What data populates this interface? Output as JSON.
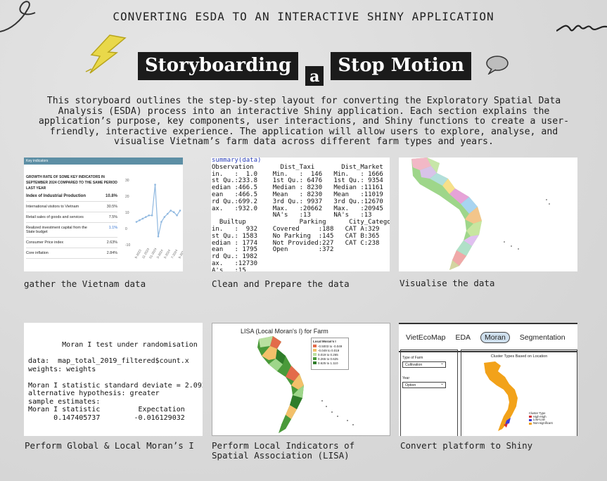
{
  "header": {
    "title": "CONVERTING ESDA TO AN INTERACTIVE SHINY APPLICATION",
    "banner_word1": "Storyboarding",
    "banner_word2": "a",
    "banner_word3": "Stop Motion"
  },
  "intro": "This storyboard outlines the step-by-step layout for converting the Exploratory Spatial Data Analysis (ESDA) process into an interactive Shiny application. Each section explains the application’s purpose, key components, user interactions, and Shiny functions to create a user-friendly, interactive experience. The application will allow users to explore, analyse, and visualise Vietnam’s farm data across different farm types and years.",
  "cards": [
    {
      "caption": "gather the Vietnam data"
    },
    {
      "caption": "Clean and Prepare the data"
    },
    {
      "caption": "Visualise the data"
    },
    {
      "caption": "Perform Global & Local Moran’s I"
    },
    {
      "caption": "Perform Local Indicators of\nSpatial Association (LISA)"
    },
    {
      "caption": "Convert platform to Shiny"
    }
  ],
  "indicators": {
    "header": "Key indicators",
    "heading": "Growth rate of some key indicators in September 2024 compared to the same period last year",
    "rows": [
      {
        "label": "Index of Industrial Production",
        "value": "10.8%",
        "big": true
      },
      {
        "label": "International visitors to Vietnam",
        "value": "30.5%"
      },
      {
        "label": "Retail sales of goods and services",
        "value": "7.5%"
      },
      {
        "label": "Realized investment capital from the State budget",
        "value": "1.1%"
      },
      {
        "label": "Consumer Price index",
        "value": "2.63%"
      },
      {
        "label": "Core inflation",
        "value": "2.84%"
      }
    ],
    "y_ticks": [
      "30",
      "20",
      "10",
      "0",
      "-10"
    ],
    "x_ticks": [
      "9-2023",
      "11-2023",
      "01-2024",
      "3-2024",
      "5-2024",
      "7-2024",
      "9-2024"
    ]
  },
  "summary_code": "summary(data)\nObservation       Dist_Taxi       Dist_Market      Dis\nin.   :  1.0    Min.   :  146   Min.   : 1666   Min\nst Qu.:233.8    1st Qu.: 6476   1st Qu.: 9354   1st\nedian :466.5    Median : 8230   Median :11161   Med\nean   :466.5    Mean   : 8230   Mean   :11019   Mea\nrd Qu.:699.2    3rd Qu.: 9937   3rd Qu.:12670   3rd\nax.   :932.0    Max.   :20662   Max.   :20945   Max\n                NA's   :13      NA's   :13      NA'\n  Builtup              Parking      City_Category\nin.   :  932    Covered     :188   CAT A:329      Mi\nst Qu.: 1583    No Parking  :145   CAT B:365      1s\nedian : 1774    Not Provided:227   CAT C:238      Me\nean   : 1795    Open        :372                  Me\nrd Qu.: 1982                                      3r\nax.   :12730                                      Ma\nA's   :15",
  "moran_code": "        Moran I test under randomisation\n\ndata:  map_total_2019_filtered$count.x\nweights: weights\n\nMoran I statistic standard deviate = 2.092,\nalternative hypothesis: greater\nsample estimates:\nMoran I statistic         Expectation\n      0.147405737        -0.016129032        (",
  "lisa": {
    "title": "LISA (Local Moran's I) for Farm",
    "legend_title": "Local Moran's I",
    "legend": [
      "-0.5003 to -0.049",
      "-0.049 to 0.019",
      "0.019 to 0.265",
      "0.265 to 0.625",
      "0.625 to 1.110"
    ]
  },
  "shiny": {
    "tabs": [
      "VietEcoMap",
      "EDA",
      "Moran",
      "Segmentation"
    ],
    "active_tab": "Moran",
    "farm_label": "Type of Farm",
    "farm_value": "Cultivation",
    "year_label": "Year",
    "year_value": "Option",
    "plot_title": "Cluster Types Based on Location",
    "legend_title": "Cluster Type",
    "legend": [
      "High-High",
      "Low-Low",
      "Non-significant"
    ]
  },
  "colors": {
    "background": "#dcdcdc",
    "banner": "#1b1b1b",
    "accent_orange": "#f2a21a",
    "shiny_tab_active": "#cfe0ee"
  }
}
